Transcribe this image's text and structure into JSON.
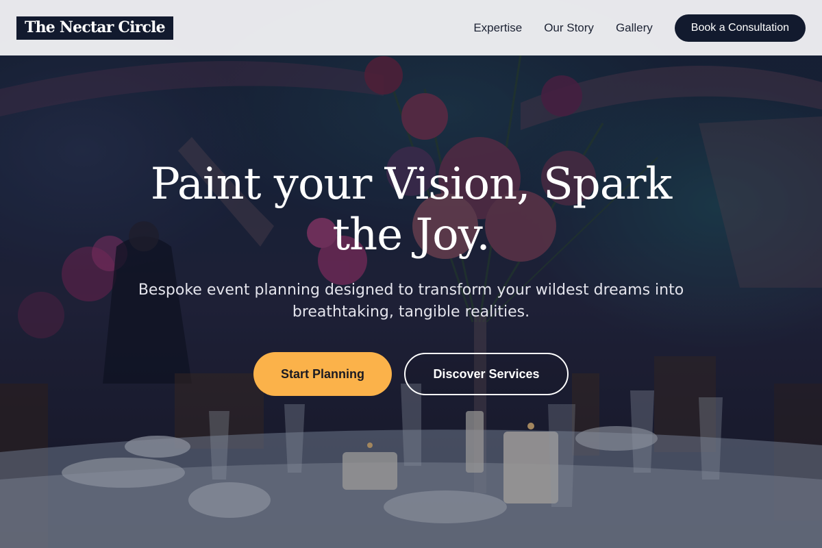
{
  "brand": {
    "name": "The Nectar Circle"
  },
  "nav": {
    "links": [
      {
        "label": "Expertise"
      },
      {
        "label": "Our Story"
      },
      {
        "label": "Gallery"
      }
    ],
    "cta_label": "Book a Consultation"
  },
  "hero": {
    "title": "Paint your Vision, Spark the Joy.",
    "subtitle": "Bespoke event planning designed to transform your wildest dreams into breathtaking, tangible realities.",
    "primary_button": "Start Planning",
    "secondary_button": "Discover Services",
    "background_image": "evening-banquet-table-with-floral-centerpiece-and-candles"
  },
  "colors": {
    "header_bg": "#f4f4f6",
    "brand_dark": "#121a2e",
    "accent": "#fbb24a",
    "hero_text": "#ffffff"
  }
}
